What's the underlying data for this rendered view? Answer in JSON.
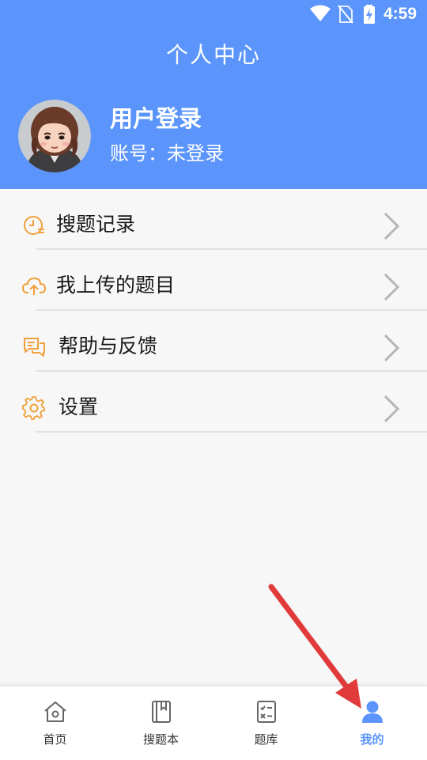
{
  "status_bar": {
    "time": "4:59",
    "icons": [
      "wifi-icon",
      "no-sim-icon",
      "battery-charging-icon"
    ]
  },
  "header": {
    "title": "个人中心",
    "user_name": "用户登录",
    "account_text": "账号：未登录",
    "background_color": "#5b95fb"
  },
  "menu": {
    "items": [
      {
        "label": "搜题记录",
        "icon": "clock-history-icon"
      },
      {
        "label": "我上传的题目",
        "icon": "cloud-upload-icon"
      },
      {
        "label": "帮助与反馈",
        "icon": "chat-feedback-icon"
      },
      {
        "label": "设置",
        "icon": "gear-icon"
      }
    ],
    "icon_color": "#f0a03c"
  },
  "bottom_nav": {
    "items": [
      {
        "label": "首页",
        "icon": "home-icon",
        "active": false
      },
      {
        "label": "搜题本",
        "icon": "notebook-icon",
        "active": false
      },
      {
        "label": "题库",
        "icon": "question-bank-icon",
        "active": false
      },
      {
        "label": "我的",
        "icon": "user-icon",
        "active": true
      }
    ],
    "active_color": "#5b95fb"
  }
}
